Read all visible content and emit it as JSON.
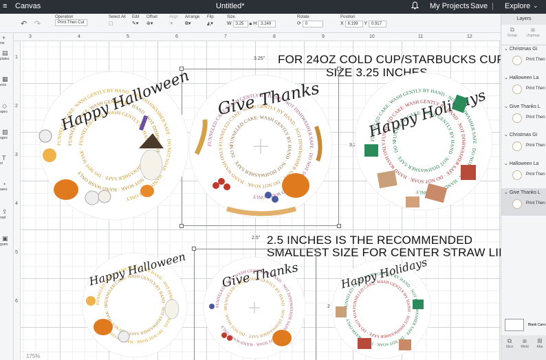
{
  "topbar": {
    "menu_icon": "≡",
    "app_label": "Canvas",
    "doc_title": "Untitled*",
    "bell_icon": "bell-icon",
    "my_projects": "My Projects",
    "save": "Save",
    "separator": "|",
    "explore": "Explore",
    "explore_chevron": "⌄"
  },
  "toolbar": {
    "operation_label": "Operation",
    "operation_value": "Print Then Cut",
    "select_all": "Select All",
    "edit": "Edit",
    "offset": "Offset",
    "align": "Align",
    "arrange": "Arrange",
    "flip": "Flip",
    "size_label": "Size",
    "w_label": "W",
    "w_value": "3.25",
    "h_label": "H",
    "h_value": "3.249",
    "rotate_label": "Rotate",
    "rotate_value": "0",
    "position_label": "Position",
    "x_label": "X",
    "x_value": "6.199",
    "y_label": "Y",
    "y_value": "0.917"
  },
  "sidebar": {
    "items": [
      {
        "label": "ow",
        "icon": "+"
      },
      {
        "label": "plates",
        "icon": "▤"
      },
      {
        "label": "ects",
        "icon": "▦"
      },
      {
        "label": "apes",
        "icon": "◇"
      },
      {
        "label": "ages",
        "icon": "▨"
      },
      {
        "label": "xt",
        "icon": "T"
      },
      {
        "label": "ases",
        "icon": "◔"
      },
      {
        "label": "oad",
        "icon": "⇪"
      },
      {
        "label": "gram",
        "icon": "▣"
      }
    ]
  },
  "ruler": {
    "top": [
      "3",
      "4",
      "5",
      "6",
      "7",
      "8",
      "9",
      "10",
      "11",
      "12"
    ],
    "left": [
      "1",
      "2",
      "3",
      "4",
      "5",
      "6"
    ]
  },
  "canvas": {
    "heading_1": "FOR 24OZ COLD CUP/STARBUCKS CUP",
    "heading_2": "SIZE 3.25 INCHES",
    "heading_3": "2.5 INCHES IS THE RECOMMENDED",
    "heading_4": "SMALLEST SIZE FOR CENTER STRAW LIDS",
    "dim_top_large": "3.25\"",
    "dim_side_large": "3.249\"",
    "dim_top_small": "2.5\"",
    "dim_side_small": "2",
    "zoom": "175%",
    "stickers": [
      {
        "title": "Happy Halloween",
        "ring": "FUNNELED CAKE: WASH GENTLY BY HAND · NOT DISHWASHER SAFE · DO NOT SOAK · HAND WASH ONLY",
        "theme": "halloween"
      },
      {
        "title": "Give Thanks",
        "ring": "FUNNELED CAKE: WASH GENTLY BY HAND · NOT DISHWASHER SAFE · DO NOT SOAK · HAND WASH ONLY",
        "theme": "thanks"
      },
      {
        "title": "Happy Holidays",
        "ring": "FUNNELED CAKE: WASH GENTLY BY HAND · NOT DISHWASHER SAFE · DO NOT SOAK · HAND WASH ONLY",
        "theme": "holiday"
      },
      {
        "title": "Happy Halloween",
        "ring": "FUNNELED CAKE: WASH GENTLY BY HAND · NOT DISHWASHER SAFE · DO NOT SOAK · HAND WASH ONLY",
        "theme": "halloween"
      },
      {
        "title": "Give Thanks",
        "ring": "FUNNELED CAKE: WASH GENTLY BY HAND · NOT DISHWASHER SAFE · DO NOT SOAK · HAND WASH ONLY",
        "theme": "thanks"
      },
      {
        "title": "Happy Holidays",
        "ring": "FUNNELED CAKE: WASH GENTLY BY HAND · NOT DISHWASHER SAFE · DO NOT SOAK · HAND WASH ONLY",
        "theme": "holiday"
      }
    ]
  },
  "layers_panel": {
    "title": "Layers",
    "group": "Group",
    "ungroup": "Ungroup",
    "layers": [
      {
        "name": "Christmas Gi",
        "sub": "Print Then"
      },
      {
        "name": "Halloween La",
        "sub": "Print Then"
      },
      {
        "name": "Give Thanks L",
        "sub": "Print Then"
      },
      {
        "name": "Christmas Gi",
        "sub": "Print Then"
      },
      {
        "name": "Halloween La",
        "sub": "Print Then"
      },
      {
        "name": "Give Thanks L",
        "sub": "Print Then"
      }
    ],
    "blank_canvas": "Blank Canv",
    "actions": [
      "Slice",
      "Weld",
      "Atta"
    ]
  },
  "colors": {
    "topbar": "#2b2f36",
    "halloween": "#e07a1f",
    "thanks": "#c45a2a",
    "holiday": "#1f7a4a",
    "ring_halloween": "#d39a1b",
    "ring_thanks": "#a0557a",
    "ring_holiday": "#2a7d4f"
  }
}
